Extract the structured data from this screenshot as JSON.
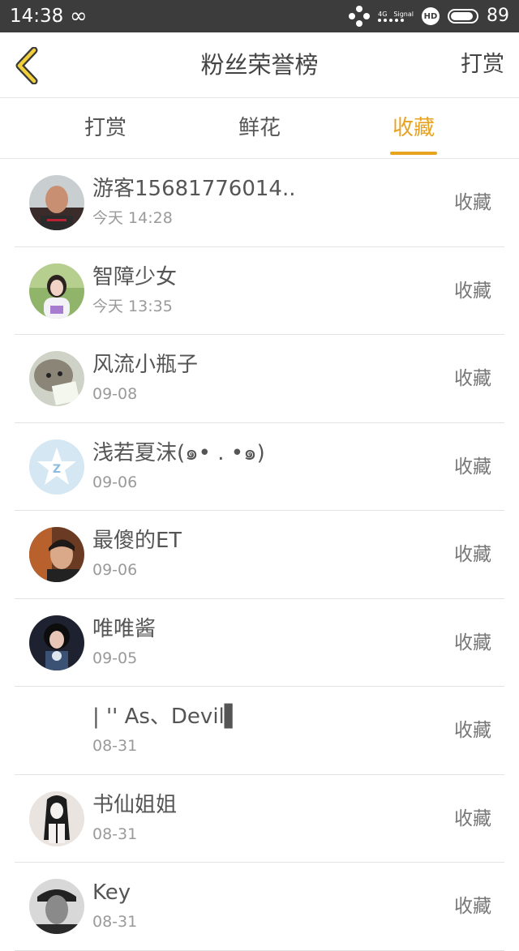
{
  "status_bar": {
    "time": "14:38",
    "network": "4G",
    "signal_label": "Signal",
    "hd": "HD",
    "battery": "89",
    "battery_level": 0.89
  },
  "header": {
    "title": "粉丝荣誉榜",
    "right_action": "打赏",
    "accent_color": "#e8a321"
  },
  "tabs": [
    {
      "label": "打赏",
      "active": false
    },
    {
      "label": "鲜花",
      "active": false
    },
    {
      "label": "收藏",
      "active": true
    }
  ],
  "fans": [
    {
      "name": "游客15681776014..",
      "date": "今天 14:28",
      "tag": "收藏",
      "avatar": "man-photo"
    },
    {
      "name": "智障少女",
      "date": "今天 13:35",
      "tag": "收藏",
      "avatar": "girl-photo"
    },
    {
      "name": "风流小瓶子",
      "date": "09-08",
      "tag": "收藏",
      "avatar": "hedgehog-photo"
    },
    {
      "name": "浅若夏沫(๑• . •๑)",
      "date": "09-06",
      "tag": "收藏",
      "avatar": "qq-star-icon"
    },
    {
      "name": "最傻的ET",
      "date": "09-06",
      "tag": "收藏",
      "avatar": "boy-photo"
    },
    {
      "name": "唯唯酱",
      "date": "09-05",
      "tag": "收藏",
      "avatar": "girl-dark-photo"
    },
    {
      "name": "| '' As、Devil▌",
      "date": "08-31",
      "tag": "收藏",
      "avatar": "none"
    },
    {
      "name": "书仙姐姐",
      "date": "08-31",
      "tag": "收藏",
      "avatar": "sketch-girl-photo"
    },
    {
      "name": "Key",
      "date": "08-31",
      "tag": "收藏",
      "avatar": "man-bw-photo"
    }
  ]
}
